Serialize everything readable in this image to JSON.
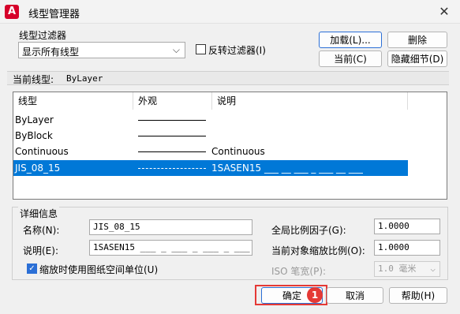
{
  "window": {
    "title": "线型管理器",
    "icon_letter": "A",
    "close": "✕"
  },
  "filter": {
    "label": "线型过滤器",
    "selected": "显示所有线型",
    "invert_label": "反转过滤器(I)"
  },
  "buttons": {
    "load": "加载(L)...",
    "delete": "删除",
    "current": "当前(C)",
    "hide_details": "隐藏细节(D)"
  },
  "current_linetype": {
    "label": "当前线型:",
    "value": "ByLayer"
  },
  "table": {
    "columns": [
      "线型",
      "外观",
      "说明"
    ],
    "rows": [
      {
        "name": "ByLayer",
        "description": ""
      },
      {
        "name": "ByBlock",
        "description": ""
      },
      {
        "name": "Continuous",
        "description": "Continuous"
      },
      {
        "name": "JIS_08_15",
        "description": "1SASEN15 ___ __ ___ _ ___ __ ___",
        "selected": true
      }
    ]
  },
  "details": {
    "legend": "详细信息",
    "name_label": "名称(N):",
    "name_value": "JIS_08_15",
    "desc_label": "说明(E):",
    "desc_value": "1SASEN15 ___ _ ___ _ ___ _ ___",
    "global_scale_label": "全局比例因子(G):",
    "global_scale_value": "1.0000",
    "object_scale_label": "当前对象缩放比例(O):",
    "object_scale_value": "1.0000",
    "iso_label": "ISO 笔宽(P):",
    "iso_value": "1.0 毫米",
    "paper_units_label": "缩放时使用图纸空间单位(U)"
  },
  "footer": {
    "ok": "确定",
    "cancel": "取消",
    "help": "帮助(H)",
    "badge": "1"
  },
  "colors": {
    "selection": "#0078d7",
    "highlight": "#e53935",
    "app_icon": "#d6002a"
  }
}
